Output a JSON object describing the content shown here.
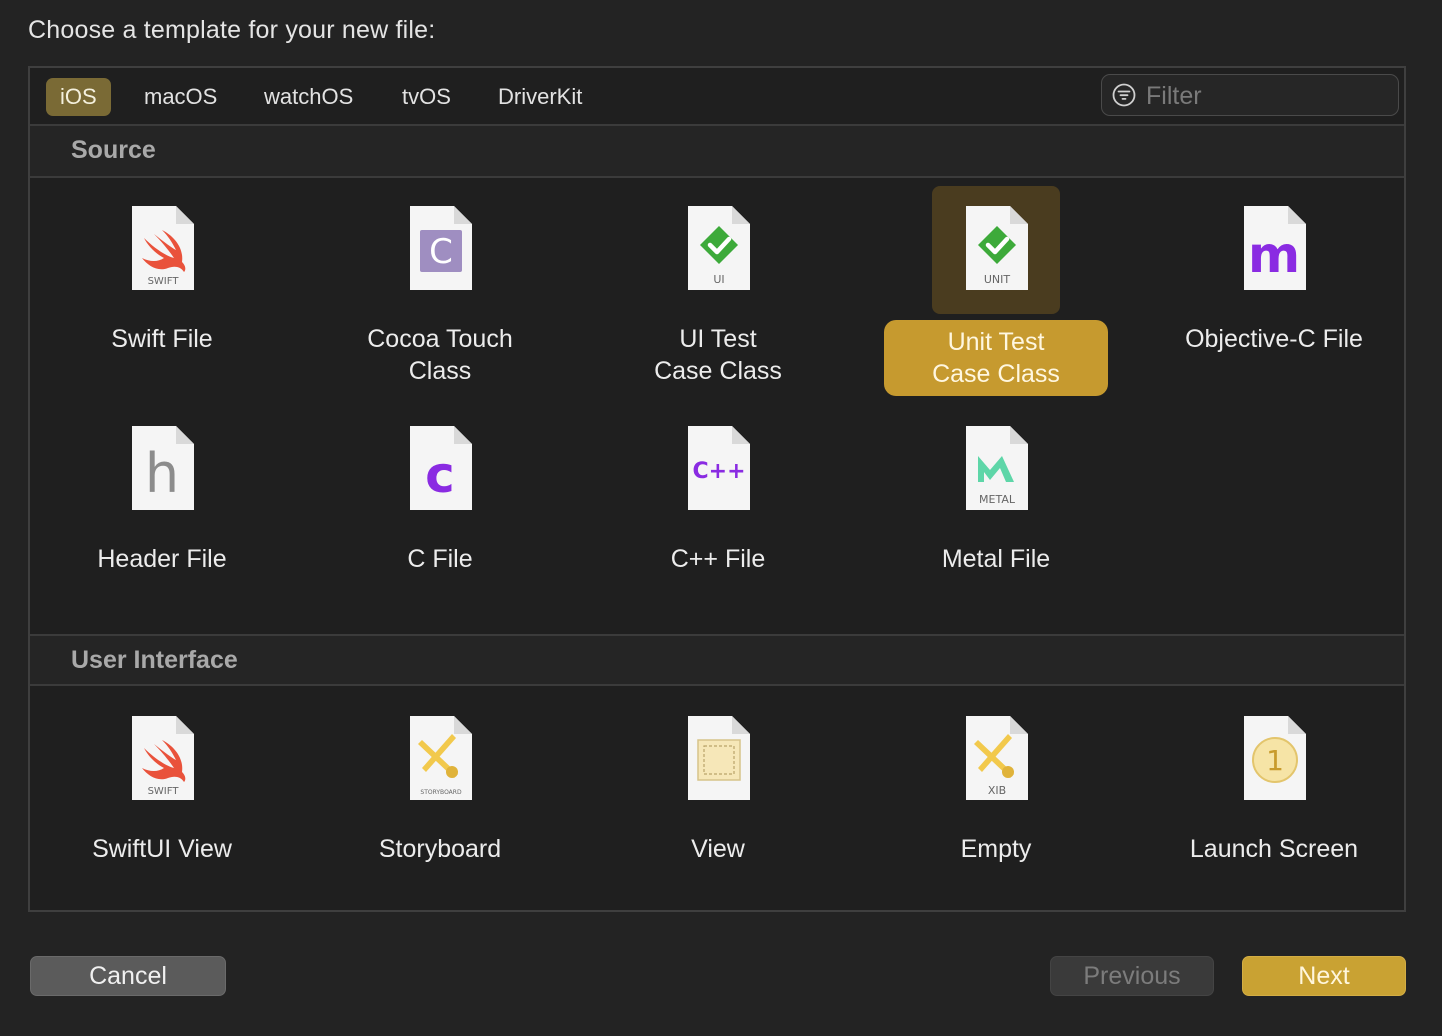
{
  "dialog": {
    "heading": "Choose a template for your new file:"
  },
  "tabs": [
    {
      "label": "iOS",
      "active": true
    },
    {
      "label": "macOS",
      "active": false
    },
    {
      "label": "watchOS",
      "active": false
    },
    {
      "label": "tvOS",
      "active": false
    },
    {
      "label": "DriverKit",
      "active": false
    }
  ],
  "filter": {
    "placeholder": "Filter",
    "value": ""
  },
  "sections": {
    "source": {
      "title": "Source",
      "items": [
        {
          "label": "Swift File",
          "icon": "swift-file-icon",
          "badge": "SWIFT"
        },
        {
          "label": "Cocoa Touch\nClass",
          "icon": "cocoa-touch-class-icon",
          "badge": "C"
        },
        {
          "label": "UI Test\nCase Class",
          "icon": "ui-test-case-icon",
          "badge": "UI"
        },
        {
          "label": "Unit Test\nCase Class",
          "icon": "unit-test-case-icon",
          "badge": "UNIT",
          "selected": true
        },
        {
          "label": "Objective-C File",
          "icon": "objective-c-file-icon",
          "badge": "m"
        },
        {
          "label": "Header File",
          "icon": "header-file-icon",
          "badge": "h"
        },
        {
          "label": "C File",
          "icon": "c-file-icon",
          "badge": "c"
        },
        {
          "label": "C++ File",
          "icon": "cpp-file-icon",
          "badge": "C++"
        },
        {
          "label": "Metal File",
          "icon": "metal-file-icon",
          "badge": "METAL"
        }
      ]
    },
    "user_interface": {
      "title": "User Interface",
      "items": [
        {
          "label": "SwiftUI View",
          "icon": "swiftui-view-icon",
          "badge": "SWIFT"
        },
        {
          "label": "Storyboard",
          "icon": "storyboard-icon",
          "badge": "STORYBOARD"
        },
        {
          "label": "View",
          "icon": "view-icon",
          "badge": ""
        },
        {
          "label": "Empty",
          "icon": "empty-xib-icon",
          "badge": "XIB"
        },
        {
          "label": "Launch Screen",
          "icon": "launch-screen-icon",
          "badge": "1"
        }
      ]
    }
  },
  "buttons": {
    "cancel": "Cancel",
    "previous": "Previous",
    "next": "Next"
  },
  "colors": {
    "accent": "#c69a2f",
    "selected_icon_bg": "#4a3c1f",
    "tab_active": "#7a6a35"
  }
}
